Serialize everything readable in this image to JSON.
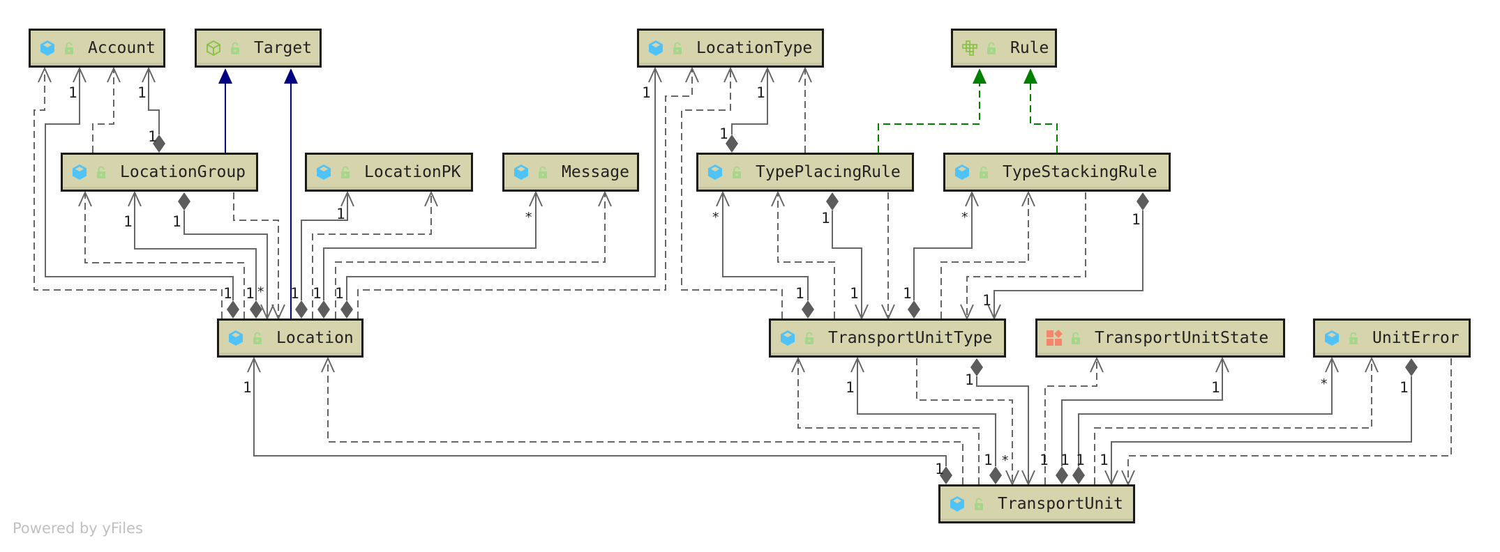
{
  "diagram": {
    "type": "UML class diagram",
    "watermark": "Powered by yFiles",
    "colors": {
      "node_fill": "#d6d4ad",
      "node_border": "#1a1a1a",
      "edge": "#666666",
      "inheritance": "#000080",
      "realization": "#008000",
      "class_icon": "#4fc3f7",
      "lock_icon": "#a5d68a",
      "interface_icon": "#8bc34a",
      "enum_icon": "#f4876b"
    },
    "nodes": [
      {
        "id": "Account",
        "label": "Account",
        "kind": "class"
      },
      {
        "id": "Target",
        "label": "Target",
        "kind": "interface"
      },
      {
        "id": "LocationType",
        "label": "LocationType",
        "kind": "class"
      },
      {
        "id": "Rule",
        "label": "Rule",
        "kind": "abstract"
      },
      {
        "id": "LocationGroup",
        "label": "LocationGroup",
        "kind": "class"
      },
      {
        "id": "LocationPK",
        "label": "LocationPK",
        "kind": "class"
      },
      {
        "id": "Message",
        "label": "Message",
        "kind": "class"
      },
      {
        "id": "TypePlacingRule",
        "label": "TypePlacingRule",
        "kind": "class"
      },
      {
        "id": "TypeStackingRule",
        "label": "TypeStackingRule",
        "kind": "class"
      },
      {
        "id": "Location",
        "label": "Location",
        "kind": "class"
      },
      {
        "id": "TransportUnitType",
        "label": "TransportUnitType",
        "kind": "class"
      },
      {
        "id": "TransportUnitState",
        "label": "TransportUnitState",
        "kind": "enum"
      },
      {
        "id": "UnitError",
        "label": "UnitError",
        "kind": "class"
      },
      {
        "id": "TransportUnit",
        "label": "TransportUnit",
        "kind": "class"
      }
    ],
    "edges": [
      {
        "from": "Location",
        "to": "Account",
        "type": "dependency"
      },
      {
        "from": "Location",
        "to": "Account",
        "type": "composition",
        "source_mult": "1",
        "target_mult": "1"
      },
      {
        "from": "LocationGroup",
        "to": "Account",
        "type": "dependency"
      },
      {
        "from": "LocationGroup",
        "to": "Account",
        "type": "composition",
        "source_mult": "1",
        "target_mult": "1"
      },
      {
        "from": "LocationGroup",
        "to": "Target",
        "type": "inheritance"
      },
      {
        "from": "Location",
        "to": "Target",
        "type": "inheritance"
      },
      {
        "from": "Location",
        "to": "LocationGroup",
        "type": "dependency"
      },
      {
        "from": "Location",
        "to": "LocationGroup",
        "type": "composition",
        "source_mult": "1",
        "target_mult": "1"
      },
      {
        "from": "LocationGroup",
        "to": "Location",
        "type": "composition",
        "source_mult": "1",
        "target_mult": "*"
      },
      {
        "from": "LocationGroup",
        "to": "Location",
        "type": "dependency"
      },
      {
        "from": "Location",
        "to": "LocationPK",
        "type": "composition",
        "source_mult": "1",
        "target_mult": "1"
      },
      {
        "from": "Location",
        "to": "LocationPK",
        "type": "dependency"
      },
      {
        "from": "Location",
        "to": "Message",
        "type": "composition",
        "source_mult": "1",
        "target_mult": "*"
      },
      {
        "from": "Location",
        "to": "Message",
        "type": "dependency"
      },
      {
        "from": "Location",
        "to": "LocationType",
        "type": "composition",
        "source_mult": "1",
        "target_mult": "1"
      },
      {
        "from": "Location",
        "to": "LocationType",
        "type": "dependency"
      },
      {
        "from": "TransportUnitType",
        "to": "LocationType",
        "type": "dependency"
      },
      {
        "from": "TypePlacingRule",
        "to": "LocationType",
        "type": "composition",
        "source_mult": "1",
        "target_mult": "1"
      },
      {
        "from": "TypePlacingRule",
        "to": "LocationType",
        "type": "dependency"
      },
      {
        "from": "TypePlacingRule",
        "to": "Rule",
        "type": "realization"
      },
      {
        "from": "TypeStackingRule",
        "to": "Rule",
        "type": "realization"
      },
      {
        "from": "TransportUnitType",
        "to": "TypePlacingRule",
        "type": "composition",
        "source_mult": "1",
        "target_mult": "*"
      },
      {
        "from": "TransportUnitType",
        "to": "TypePlacingRule",
        "type": "dependency"
      },
      {
        "from": "TypePlacingRule",
        "to": "TransportUnitType",
        "type": "composition",
        "source_mult": "1",
        "target_mult": "1"
      },
      {
        "from": "TypePlacingRule",
        "to": "TransportUnitType",
        "type": "dependency"
      },
      {
        "from": "TransportUnitType",
        "to": "TypeStackingRule",
        "type": "composition",
        "source_mult": "1",
        "target_mult": "*"
      },
      {
        "from": "TransportUnitType",
        "to": "TypeStackingRule",
        "type": "dependency"
      },
      {
        "from": "TypeStackingRule",
        "to": "TransportUnitType",
        "type": "dependency"
      },
      {
        "from": "TypeStackingRule",
        "to": "TransportUnitType",
        "type": "composition",
        "source_mult": "1",
        "target_mult": "1"
      },
      {
        "from": "TransportUnit",
        "to": "Location",
        "type": "composition",
        "source_mult": "1",
        "target_mult": "1"
      },
      {
        "from": "TransportUnit",
        "to": "Location",
        "type": "dependency"
      },
      {
        "from": "TransportUnit",
        "to": "TransportUnitType",
        "type": "dependency"
      },
      {
        "from": "TransportUnit",
        "to": "TransportUnitType",
        "type": "composition",
        "source_mult": "1",
        "target_mult": "1"
      },
      {
        "from": "TransportUnitType",
        "to": "TransportUnit",
        "type": "dependency",
        "target_mult": "*"
      },
      {
        "from": "TransportUnitType",
        "to": "TransportUnit",
        "type": "composition",
        "source_mult": "1",
        "target_mult": "1"
      },
      {
        "from": "TransportUnit",
        "to": "TransportUnitState",
        "type": "dependency"
      },
      {
        "from": "TransportUnit",
        "to": "TransportUnitState",
        "type": "composition",
        "source_mult": "1",
        "target_mult": "1"
      },
      {
        "from": "TransportUnit",
        "to": "UnitError",
        "type": "composition",
        "source_mult": "1",
        "target_mult": "*"
      },
      {
        "from": "TransportUnit",
        "to": "UnitError",
        "type": "dependency"
      },
      {
        "from": "UnitError",
        "to": "TransportUnit",
        "type": "composition",
        "source_mult": "1",
        "target_mult": "1"
      },
      {
        "from": "UnitError",
        "to": "TransportUnit",
        "type": "dependency"
      }
    ]
  }
}
